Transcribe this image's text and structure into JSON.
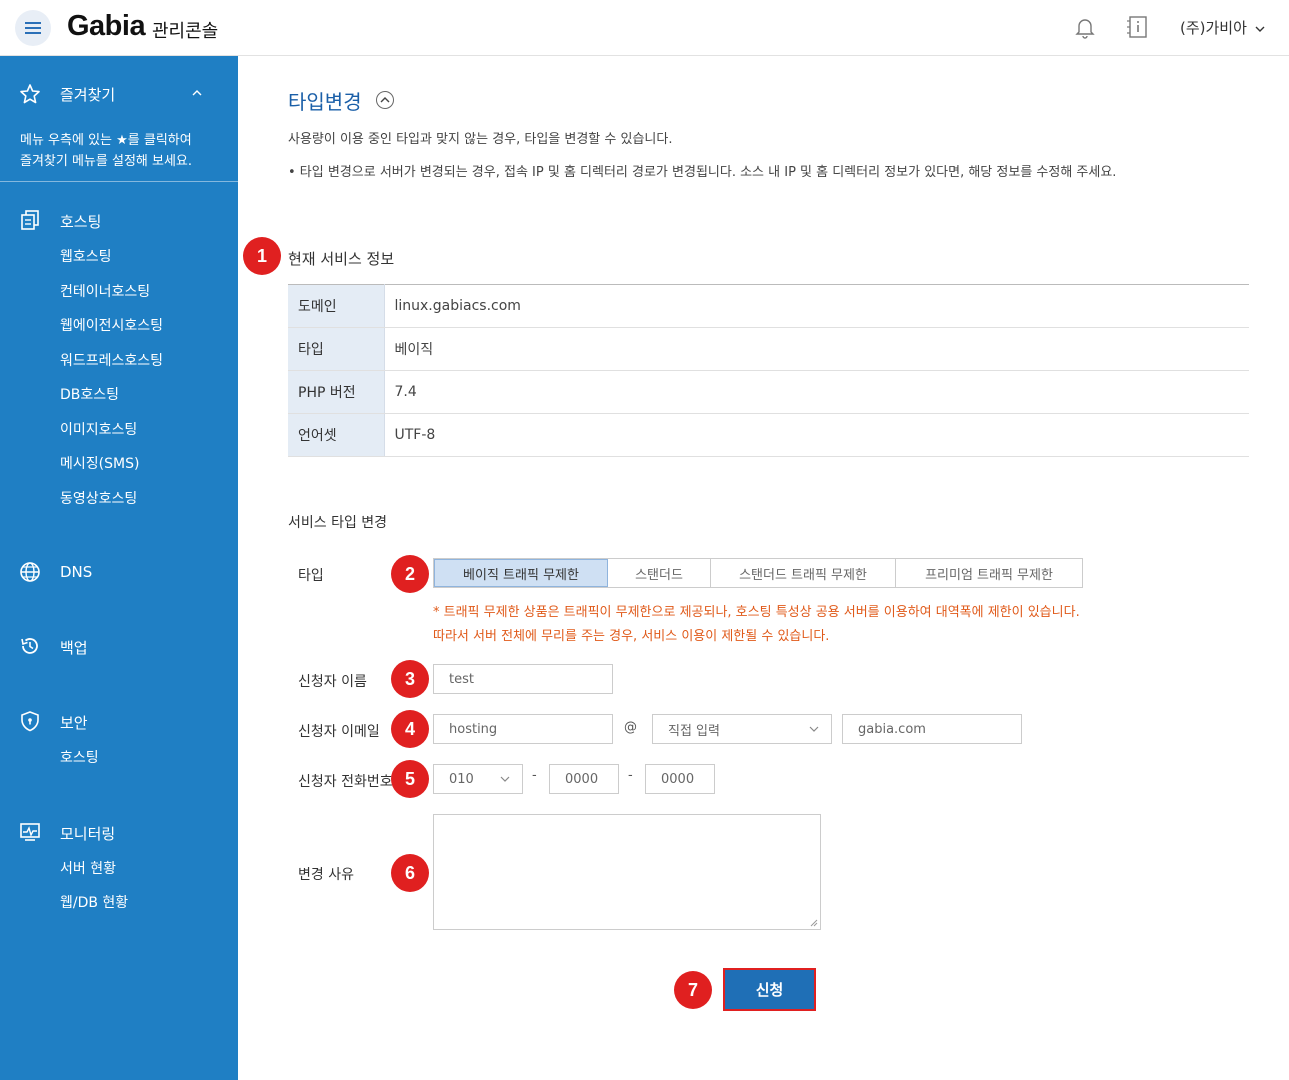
{
  "header": {
    "logo": "Gabia",
    "logo_sub": "관리콘솔",
    "company": "(주)가비아"
  },
  "sidebar": {
    "favorites": "즐겨찾기",
    "note_line1": "메뉴 우측에 있는 ★를 클릭하여",
    "note_line2": "즐겨찾기 메뉴를 설정해 보세요.",
    "hosting": "호스팅",
    "hosting_items": [
      "웹호스팅",
      "컨테이너호스팅",
      "웹에이전시호스팅",
      "워드프레스호스팅",
      "DB호스팅",
      "이미지호스팅",
      "메시징(SMS)",
      "동영상호스팅"
    ],
    "dns": "DNS",
    "backup": "백업",
    "security": "보안",
    "security_items": [
      "호스팅"
    ],
    "monitoring": "모니터링",
    "monitoring_items": [
      "서버 현황",
      "웹/DB 현황"
    ]
  },
  "page": {
    "title": "타입변경",
    "desc": "사용량이 이용 중인 타입과 맞지 않는 경우, 타입을 변경할 수 있습니다.",
    "bullet": "•  타입 변경으로 서버가 변경되는 경우, 접속 IP 및 홈 디렉터리 경로가 변경됩니다. 소스 내 IP 및 홈 디렉터리 정보가 있다면, 해당 정보를 수정해 주세요."
  },
  "current_info": {
    "title": "현재 서비스 정보",
    "rows": [
      {
        "label": "도메인",
        "value": "linux.gabiacs.com"
      },
      {
        "label": "타입",
        "value": "베이직"
      },
      {
        "label": "PHP 버전",
        "value": "7.4"
      },
      {
        "label": "언어셋",
        "value": "UTF-8"
      }
    ]
  },
  "change_form": {
    "title": "서비스 타입 변경",
    "type_label": "타입",
    "type_options": [
      "베이직 트래픽 무제한",
      "스탠더드",
      "스탠더드 트래픽 무제한",
      "프리미엄 트래픽 무제한"
    ],
    "note1": "* 트래픽 무제한 상품은 트래픽이 무제한으로 제공되나, 호스팅 특성상 공용 서버를 이용하여 대역폭에 제한이 있습니다.",
    "note2": "따라서 서버 전체에 무리를 주는 경우, 서비스 이용이 제한될 수 있습니다.",
    "name_label": "신청자 이름",
    "name_value": "test",
    "email_label": "신청자 이메일",
    "email_id": "hosting",
    "email_at": "@",
    "email_select": "직접 입력",
    "email_domain": "gabia.com",
    "phone_label": "신청자 전화번호",
    "phone1": "010",
    "phone2": "0000",
    "phone3": "0000",
    "phone_sep": "-",
    "reason_label": "변경 사유",
    "reason_value": "",
    "submit": "신청"
  },
  "badges": [
    "1",
    "2",
    "3",
    "4",
    "5",
    "6",
    "7"
  ],
  "colors": {
    "sidebar": "#1f7fc4",
    "accent": "#1a5fa8",
    "badge": "#e02020",
    "note": "#e05a1a"
  }
}
